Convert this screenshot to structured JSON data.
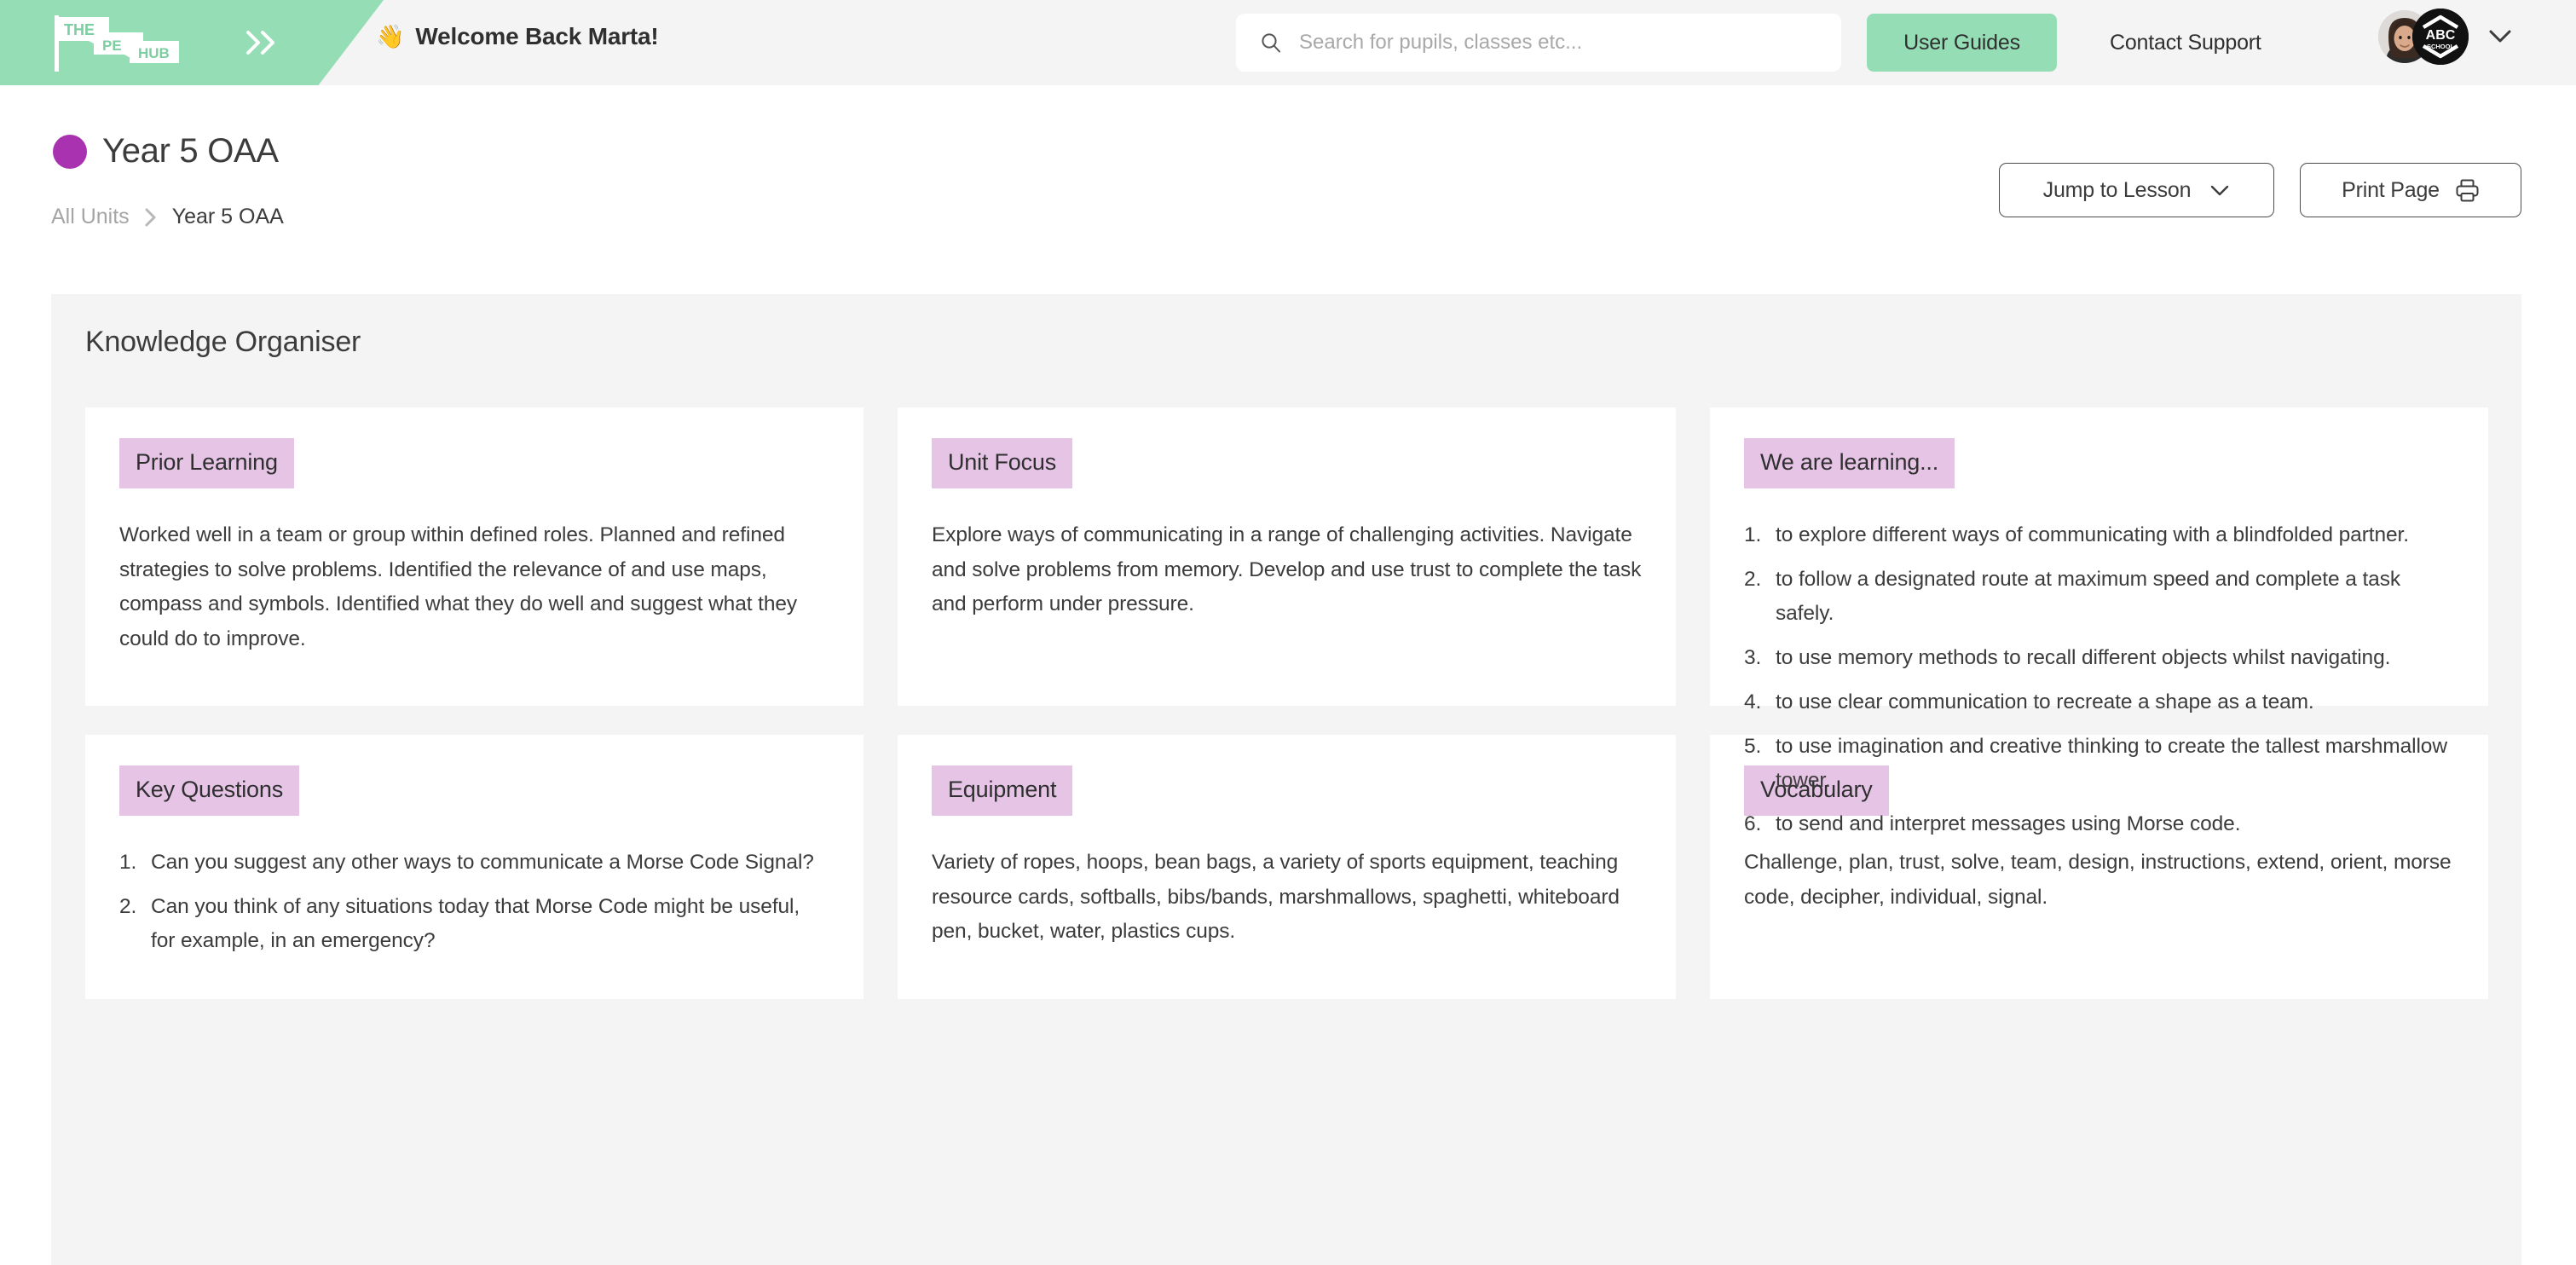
{
  "header": {
    "logo": {
      "line1": "THE",
      "line2": "PE",
      "line3": "HUB"
    },
    "collapse_icon": "chevron-double-right-icon",
    "welcome_emoji": "👋",
    "welcome_text": "Welcome Back Marta!",
    "search": {
      "placeholder": "Search for pupils, classes etc...",
      "value": "",
      "icon": "search-icon"
    },
    "user_guides_label": "User Guides",
    "contact_support_label": "Contact Support",
    "avatar_alt": "Marta profile photo",
    "school_badge": {
      "name": "ABC",
      "subtitle": "SCHOOL"
    },
    "profile_chevron_icon": "chevron-down-icon",
    "colors": {
      "brand_green": "#95ddb5",
      "bar_background": "#f4f4f4"
    }
  },
  "page": {
    "unit_dot_color": "#a832b0",
    "title": "Year 5 OAA",
    "breadcrumb": {
      "root": "All Units",
      "separator": "›",
      "current": "Year 5 OAA"
    },
    "jump_to_lesson": {
      "label": "Jump to Lesson",
      "icon": "chevron-down-icon"
    },
    "print_page": {
      "label": "Print Page",
      "icon": "printer-icon"
    }
  },
  "knowledge_organiser": {
    "heading": "Knowledge Organiser",
    "badge_color": "#e6c4e6",
    "cards": [
      {
        "badge": "Prior Learning",
        "body": "Worked well in a team or group within defined roles. Planned and refined strategies to solve problems. Identified the relevance of and use maps, compass and symbols. Identified what they do well and suggest what they could do to improve."
      },
      {
        "badge": "Unit Focus",
        "body": "Explore ways of communicating in a range of challenging activities. Navigate and solve problems from memory. Develop and use trust to complete the task and perform under pressure."
      },
      {
        "badge": "We are learning...",
        "items": [
          "to explore different ways of communicating with a blindfolded partner.",
          "to follow a designated route at maximum speed and complete a task safely.",
          "to use memory methods to recall different objects whilst navigating.",
          "to use clear communication to recreate a shape as a team.",
          "to use imagination and creative thinking to create the tallest marshmallow tower.",
          "to send and interpret messages using Morse code."
        ]
      },
      {
        "badge": "Key Questions",
        "items": [
          "Can you suggest any other ways to communicate a Morse Code Signal?",
          "Can you think of any situations today that Morse Code might be useful, for example, in an emergency?"
        ]
      },
      {
        "badge": "Equipment",
        "body": "Variety of ropes, hoops, bean bags, a variety of sports equipment, teaching resource cards, softballs, bibs/bands, marshmallows, spaghetti, whiteboard pen, bucket, water, plastics cups."
      },
      {
        "badge": "Vocabulary",
        "body": "Challenge, plan, trust, solve, team, design, instructions, extend, orient, morse code, decipher, individual, signal."
      }
    ]
  }
}
